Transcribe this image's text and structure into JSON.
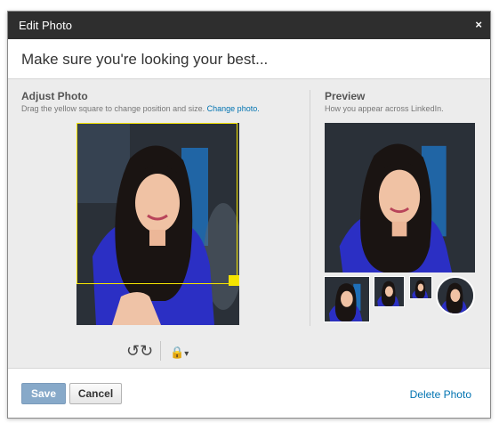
{
  "dialog": {
    "title": "Edit Photo",
    "close_label": "×",
    "heading": "Make sure you're looking your best..."
  },
  "adjust": {
    "title": "Adjust Photo",
    "description": "Drag the yellow square to change position and size.",
    "change_link": "Change photo."
  },
  "preview": {
    "title": "Preview",
    "description": "How you appear across LinkedIn."
  },
  "toolbar": {
    "rotate_icon": "↺↻",
    "lock_icon": "🔒",
    "lock_caret": "▾"
  },
  "footer": {
    "save_label": "Save",
    "cancel_label": "Cancel",
    "delete_label": "Delete Photo"
  },
  "colors": {
    "titlebar": "#2e2e2e",
    "crop_box": "#f5e400",
    "link": "#0073b1",
    "save_button": "#87a9c9"
  }
}
